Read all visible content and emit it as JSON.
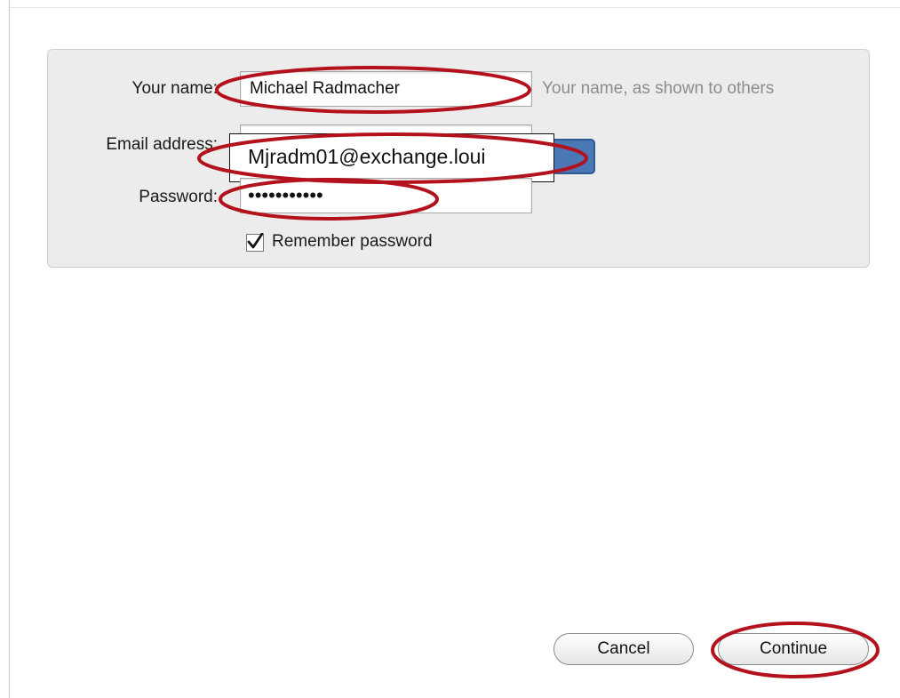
{
  "form": {
    "name_label": "Your name:",
    "name_value": "Michael Radmacher",
    "name_hint": "Your name, as shown to others",
    "email_label": "Email address:",
    "email_value": "Mjradm01@exchange.loui",
    "password_label": "Password:",
    "password_mask": "•••••••••••",
    "remember_label": "Remember password",
    "remember_checked": true
  },
  "buttons": {
    "cancel_label": "Cancel",
    "continue_label": "Continue"
  },
  "colors": {
    "annotation": "#b3121d",
    "panel_bg": "#ececec",
    "accent_blue": "#4a78b5"
  },
  "icons": {
    "checkmark": "check-icon"
  }
}
